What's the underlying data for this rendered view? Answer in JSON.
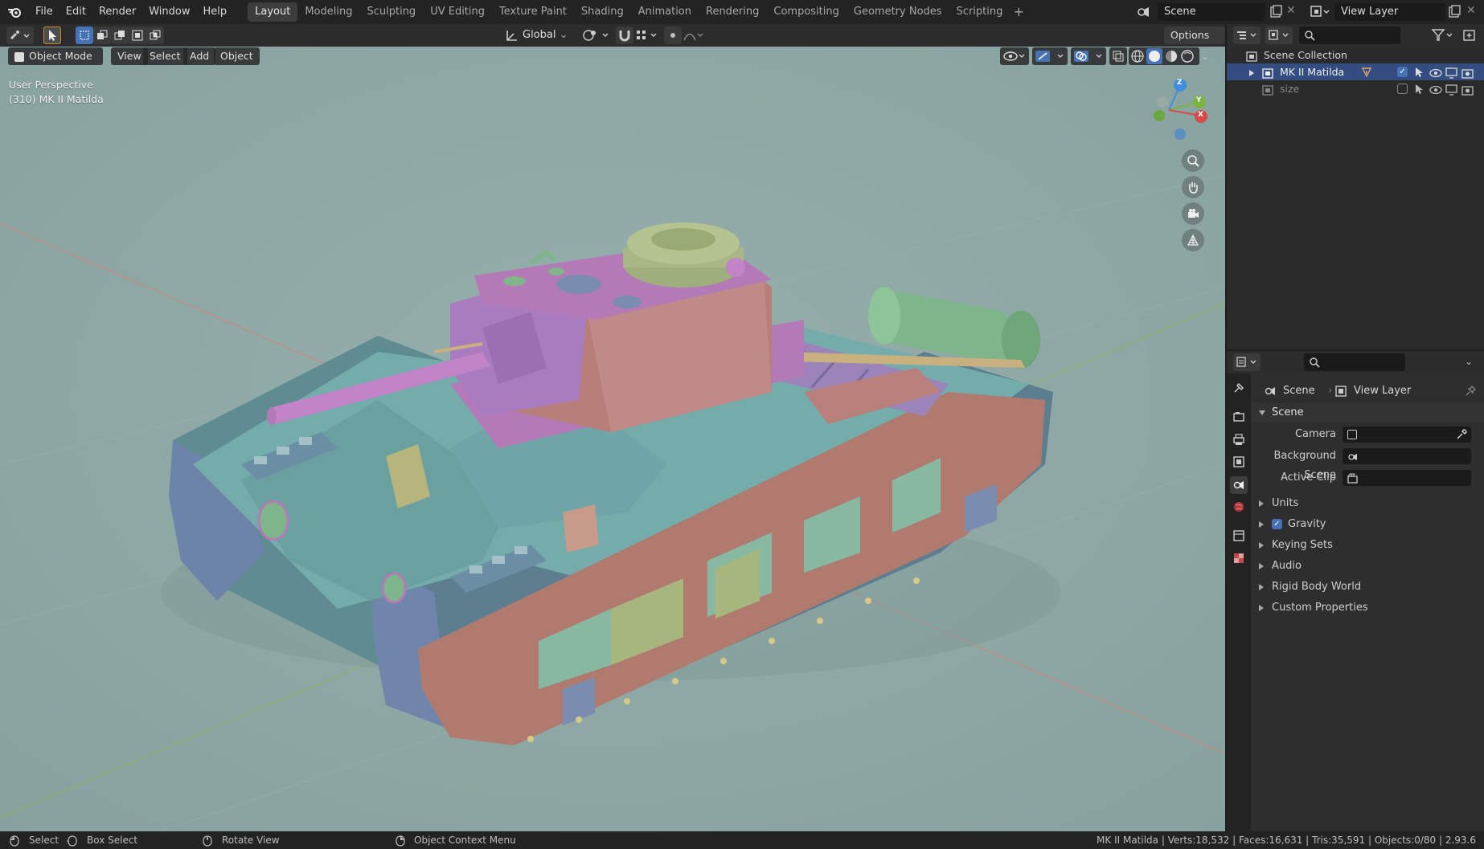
{
  "menu": [
    "File",
    "Edit",
    "Render",
    "Window",
    "Help"
  ],
  "workspaces": [
    "Layout",
    "Modeling",
    "Sculpting",
    "UV Editing",
    "Texture Paint",
    "Shading",
    "Animation",
    "Rendering",
    "Compositing",
    "Geometry Nodes",
    "Scripting"
  ],
  "active_workspace": "Layout",
  "top_right": {
    "scene": "Scene",
    "view_layer": "View Layer"
  },
  "viewport_header": {
    "orientation": "Global",
    "options": "Options"
  },
  "mode_bar": {
    "mode": "Object Mode",
    "view": "View",
    "select": "Select",
    "add": "Add",
    "object": "Object"
  },
  "overlay": {
    "perspective": "User Perspective",
    "object_info": "(310) MK II Matilda"
  },
  "gizmo": {
    "z": "Z",
    "y": "Y",
    "x": "X"
  },
  "outliner": {
    "scene_collection": "Scene Collection",
    "items": [
      {
        "name": "MK II Matilda",
        "selected": true
      },
      {
        "name": "size",
        "selected": false
      }
    ]
  },
  "properties": {
    "breadcrumb_scene": "Scene",
    "breadcrumb_layer": "View Layer",
    "section": "Scene",
    "fields": [
      {
        "label": "Camera",
        "value": ""
      },
      {
        "label": "Background Scene",
        "value": ""
      },
      {
        "label": "Active Clip",
        "value": ""
      }
    ],
    "panels": [
      {
        "label": "Units",
        "checkbox": false
      },
      {
        "label": "Gravity",
        "checkbox": true
      },
      {
        "label": "Keying Sets",
        "checkbox": false
      },
      {
        "label": "Audio",
        "checkbox": false
      },
      {
        "label": "Rigid Body World",
        "checkbox": false
      },
      {
        "label": "Custom Properties",
        "checkbox": false
      }
    ]
  },
  "statusbar": {
    "select": "Select",
    "box_select": "Box Select",
    "rotate": "Rotate View",
    "context_menu": "Object Context Menu",
    "stats": "MK II Matilda | Verts:18,532 | Faces:16,631 | Tris:35,591 | Objects:0/80 | 2.93.6"
  },
  "colors": {
    "viewport_bg": "#8fa9a6",
    "hull": "#6ea3a3",
    "side_skirt": "#b07b6e",
    "turret": "#b77e7a",
    "accent_purple": "#b47ab8",
    "accent_green": "#7fb58a",
    "x_axis": "#d84a4a",
    "y_axis": "#7cb342",
    "z_axis": "#3f8de0"
  }
}
